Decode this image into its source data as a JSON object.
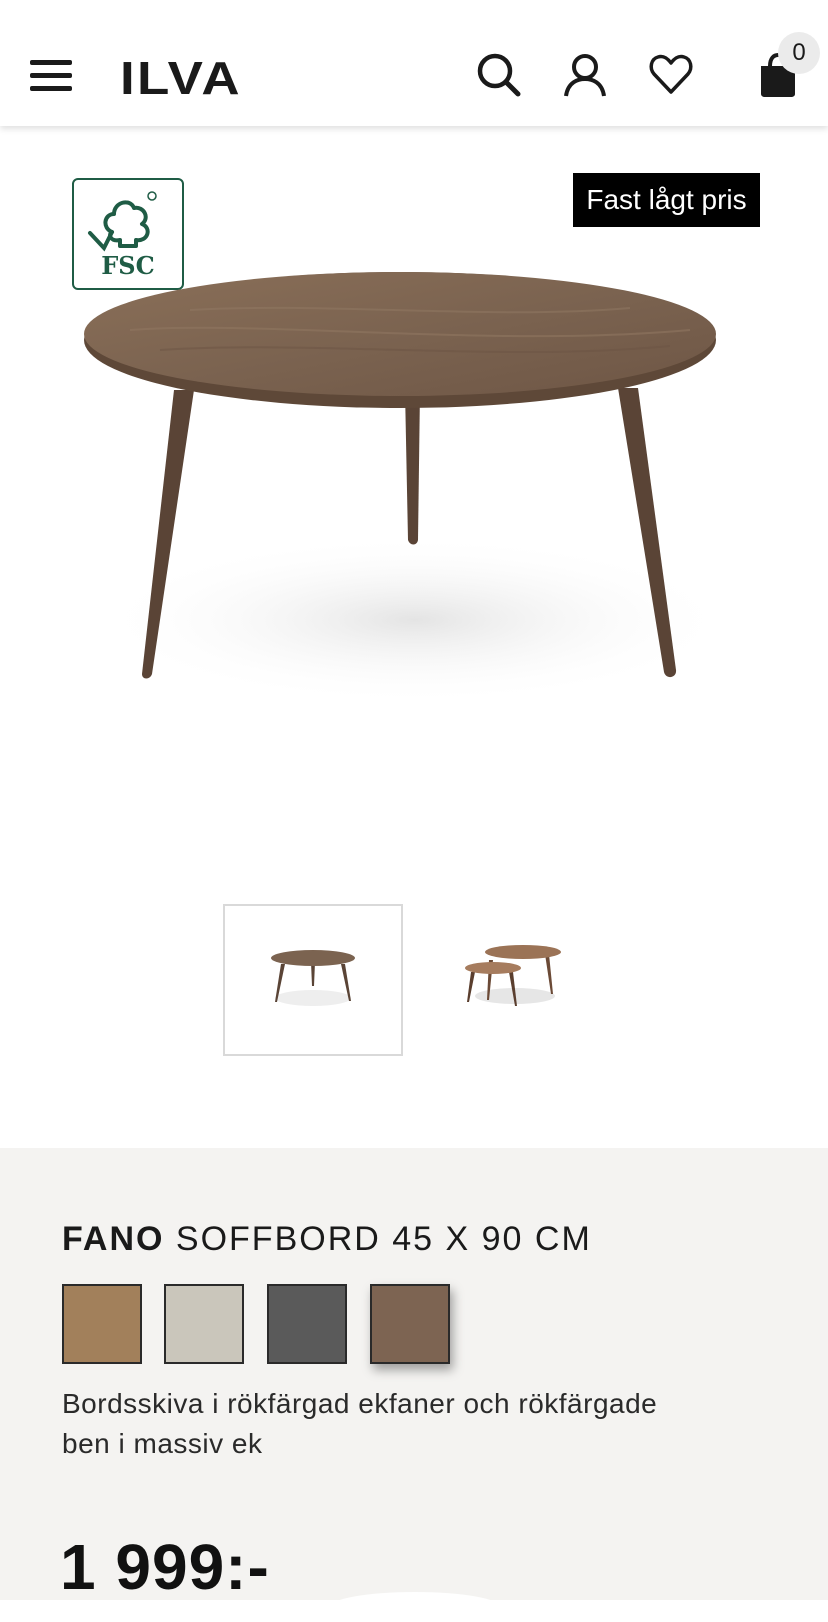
{
  "header": {
    "logo": "ILVA",
    "cart_count": "0",
    "icons": [
      "menu-icon",
      "search-icon",
      "user-icon",
      "heart-icon",
      "shopping-bag-icon"
    ]
  },
  "product_image": {
    "badge_fsc": "FSC",
    "price_tag": "Fast lågt pris"
  },
  "thumbnails": [
    {
      "label": "Fano soffbord",
      "active": true
    },
    {
      "label": "Fano soffbord set",
      "active": false
    }
  ],
  "product": {
    "brand": "FANO",
    "name": "SOFFBORD 45 X 90 CM",
    "swatches": [
      {
        "color": "#a2805b",
        "selected": false
      },
      {
        "color": "#cac6bb",
        "selected": false
      },
      {
        "color": "#5a5a5a",
        "selected": false
      },
      {
        "color": "#7d6452",
        "selected": true
      }
    ],
    "description": "Bordsskiva i rökfärgad ekfaner och rökfärgade ben i massiv ek",
    "price": "1 999:-"
  }
}
